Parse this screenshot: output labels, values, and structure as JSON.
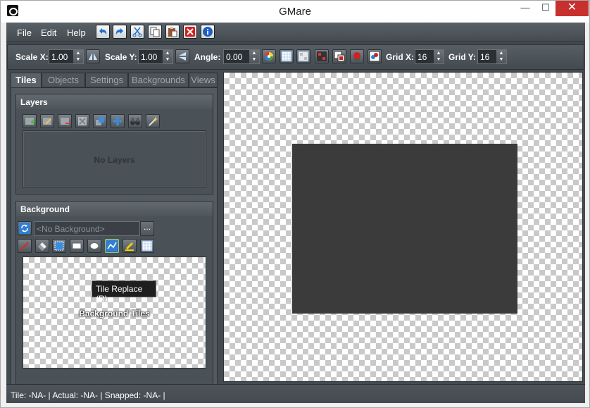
{
  "window": {
    "title": "GMare",
    "minimize": "—",
    "maximize": "☐",
    "close": "✕"
  },
  "menu": {
    "file": "File",
    "edit": "Edit",
    "help": "Help"
  },
  "toolbar_icons": [
    "undo-icon",
    "redo-icon",
    "cut-icon",
    "copy-icon",
    "paste-icon",
    "delete-icon",
    "info-icon"
  ],
  "transform": {
    "scale_x_label": "Scale X:",
    "scale_x": "1.00",
    "scale_y_label": "Scale Y:",
    "scale_y": "1.00",
    "angle_label": "Angle:",
    "angle": "0.00",
    "grid_x_label": "Grid X:",
    "grid_x": "16",
    "grid_y_label": "Grid Y:",
    "grid_y": "16"
  },
  "tabs": [
    "Tiles",
    "Objects",
    "Settings",
    "Backgrounds",
    "Views"
  ],
  "active_tab": "Tiles",
  "layers": {
    "title": "Layers",
    "empty": "No Layers"
  },
  "background": {
    "title": "Background",
    "select_placeholder": "<No Background>",
    "more": "...",
    "tiles_label": "Background Tiles"
  },
  "tooltip": "Tile Replace (R)",
  "status": "Tile: -NA- | Actual: -NA- | Snapped: -NA- |",
  "colors": {
    "panel": "#434a50",
    "room": "#3b3b3b",
    "close": "#c7302c",
    "accent_blue": "#2f7fd3"
  }
}
